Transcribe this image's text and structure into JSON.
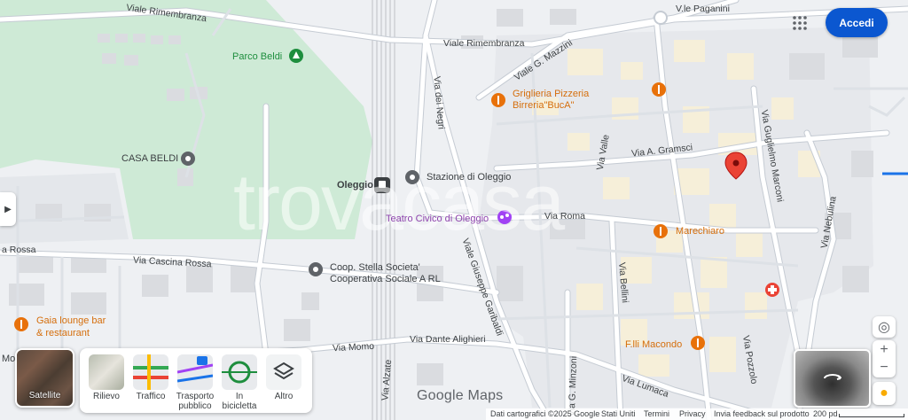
{
  "watermark": "trovacasa",
  "header": {
    "signin_label": "Accedi",
    "apps_icon": "grid-icon"
  },
  "streets": {
    "rimembranza_1": "Viale Rimembranza",
    "rimembranza_2": "Viale Rimembranza",
    "paganini": "V.le Paganini",
    "mazzini": "Viale G. Mazzini",
    "negri": "Via dei Negri",
    "gramsci": "Via A. Gramsci",
    "valle": "Via Valle",
    "marconi": "Via Guglielmo Marconi",
    "roma": "Via Roma",
    "nebulina": "Via Nebulina",
    "cascina_rossa": "Via Cascina Rossa",
    "rossa": "a Rossa",
    "garibaldi": "Viale Giuseppe Garibaldi",
    "bellini": "Via Bellini",
    "momo": "Via Momo",
    "dante": "Via Dante Alighieri",
    "alzate": "Via Alzate",
    "minzoni": "Via G. Minzoni",
    "lumaca": "Via Lumaca",
    "pozzolo": "Via Pozzolo"
  },
  "places": {
    "parco_beldi": "Parco Beldi",
    "casa_beldi": "CASA BELDI",
    "oleggio": "Oleggio",
    "stazione": "Stazione di Oleggio",
    "teatro": "Teatro Civico di Oleggio",
    "griglieria_1": "Griglieria Pizzeria",
    "griglieria_2": "Birreria\"BucA\"",
    "marechiaro": "Marechiaro",
    "coop_1": "Coop. Stella Societa'",
    "coop_2": "Cooperativa Sociale A RL",
    "gaia_1": "Gaia lounge bar",
    "gaia_2": "& restaurant",
    "macondo": "F.lli Macondo",
    "mo": "Mo"
  },
  "layers": {
    "satellite": "Satellite",
    "rilievo": "Rilievo",
    "traffico": "Traffico",
    "trasporto_1": "Trasporto",
    "trasporto_2": "pubblico",
    "bicicletta_1": "In",
    "bicicletta_2": "bicicletta",
    "altro": "Altro"
  },
  "logo": "Google Maps",
  "footer": {
    "data": "Dati cartografici ©2025 Google",
    "country": "Stati Uniti",
    "terms": "Termini",
    "privacy": "Privacy",
    "feedback": "Invia feedback sul prodotto",
    "scale": "200 pd"
  },
  "colors": {
    "accent": "#0b57d0",
    "pin": "#ea4335",
    "park": "#ceead6"
  }
}
